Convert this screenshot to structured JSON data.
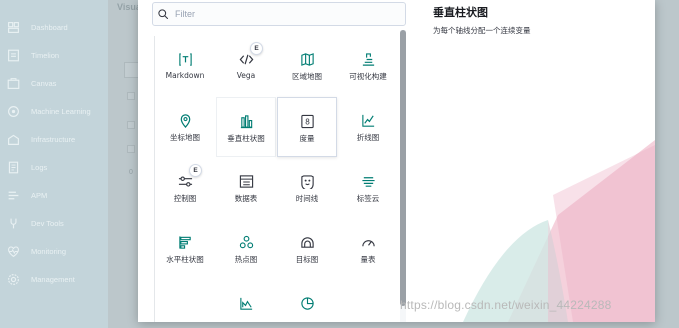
{
  "sidebar": {
    "items": [
      {
        "label": "Dashboard",
        "icon": "dashboard-icon"
      },
      {
        "label": "Timelion",
        "icon": "timelion-icon"
      },
      {
        "label": "Canvas",
        "icon": "canvas-icon"
      },
      {
        "label": "Machine Learning",
        "icon": "machine-learning-icon"
      },
      {
        "label": "Infrastructure",
        "icon": "infrastructure-icon"
      },
      {
        "label": "Logs",
        "icon": "logs-icon"
      },
      {
        "label": "APM",
        "icon": "apm-icon"
      },
      {
        "label": "Dev Tools",
        "icon": "dev-tools-icon"
      },
      {
        "label": "Monitoring",
        "icon": "monitoring-icon"
      },
      {
        "label": "Management",
        "icon": "management-icon"
      }
    ]
  },
  "background": {
    "title": "Visua",
    "footer_text": "0"
  },
  "modal": {
    "search": {
      "placeholder": "Filter",
      "value": ""
    },
    "tiles": [
      {
        "label": "Markdown",
        "icon": "markdown-icon"
      },
      {
        "label": "Vega",
        "icon": "vega-icon",
        "badge": "E"
      },
      {
        "label": "区域地图",
        "icon": "region-map-icon"
      },
      {
        "label": "可视化构建",
        "icon": "visual-builder-icon"
      },
      {
        "label": "坐标地图",
        "icon": "coordinate-map-icon"
      },
      {
        "label": "垂直柱状图",
        "icon": "vertical-bar-icon"
      },
      {
        "label": "度量",
        "icon": "metric-icon"
      },
      {
        "label": "折线图",
        "icon": "line-chart-icon"
      },
      {
        "label": "控制图",
        "icon": "controls-icon",
        "badge": "E"
      },
      {
        "label": "数据表",
        "icon": "data-table-icon"
      },
      {
        "label": "时间线",
        "icon": "timeline-icon"
      },
      {
        "label": "标签云",
        "icon": "tag-cloud-icon"
      },
      {
        "label": "水平柱状图",
        "icon": "horizontal-bar-icon"
      },
      {
        "label": "热点图",
        "icon": "heat-map-icon"
      },
      {
        "label": "目标图",
        "icon": "goal-icon"
      },
      {
        "label": "量表",
        "icon": "gauge-icon"
      },
      {
        "label": "",
        "icon": "area-chart-icon"
      },
      {
        "label": "",
        "icon": "pie-chart-icon"
      }
    ],
    "description": {
      "title": "垂直柱状图",
      "text": "为每个轴线分配一个连续变量"
    }
  },
  "watermark": "https://blog.csdn.net/weixin_44224288",
  "colors": {
    "accent": "#006bb4",
    "icon_teal": "#017d73",
    "illustration_pink": "#f3c6d3",
    "illustration_teal": "#cfe7e4"
  }
}
